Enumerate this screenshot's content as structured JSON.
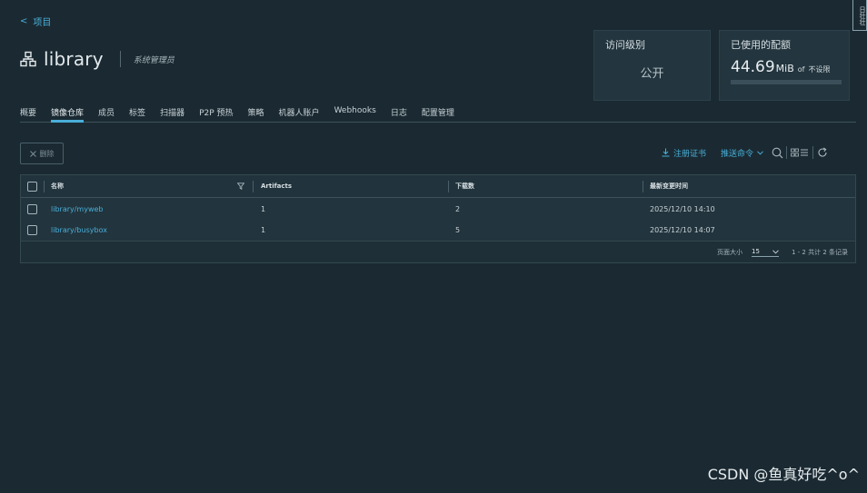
{
  "nav": {
    "back_arrow": "<",
    "back_label": "项目"
  },
  "project": {
    "name": "library",
    "role": "系统管理员"
  },
  "edge_tab": {
    "text": "日壮壮"
  },
  "cards": {
    "access": {
      "label": "访问级别",
      "value": "公开"
    },
    "quota": {
      "label": "已使用的配额",
      "used": "44.69",
      "unit": "MiB",
      "of": "of",
      "limit": "不设限",
      "usage_fraction": 0
    }
  },
  "tabs": [
    {
      "label": "概要",
      "active": false
    },
    {
      "label": "镜像仓库",
      "active": true
    },
    {
      "label": "成员",
      "active": false
    },
    {
      "label": "标签",
      "active": false
    },
    {
      "label": "扫描器",
      "active": false
    },
    {
      "label": "P2P 预热",
      "active": false
    },
    {
      "label": "策略",
      "active": false
    },
    {
      "label": "机器人账户",
      "active": false
    },
    {
      "label": "Webhooks",
      "active": false
    },
    {
      "label": "日志",
      "active": false
    },
    {
      "label": "配置管理",
      "active": false
    }
  ],
  "toolbar": {
    "delete_label": "删除",
    "delete_icon": "close-icon",
    "registry_cert_label": "注册证书",
    "push_command_label": "推送命令",
    "icons": [
      "search-icon",
      "view-toggle-icon",
      "refresh-icon"
    ]
  },
  "table": {
    "columns": [
      "名称",
      "Artifacts",
      "下载数",
      "最新变更时间"
    ],
    "rows": [
      {
        "name": "library/myweb",
        "artifacts": "1",
        "pulls": "2",
        "updated": "2025/12/10 14:10"
      },
      {
        "name": "library/busybox",
        "artifacts": "1",
        "pulls": "5",
        "updated": "2025/12/10 14:07"
      }
    ]
  },
  "pagination": {
    "page_size_label": "页面大小",
    "page_size": "15",
    "summary": "1 - 2 共计 2 条记录"
  },
  "watermark": "CSDN @鱼真好吃^o^",
  "colors": {
    "background": "#1b2a32",
    "accent": "#49afd9"
  }
}
